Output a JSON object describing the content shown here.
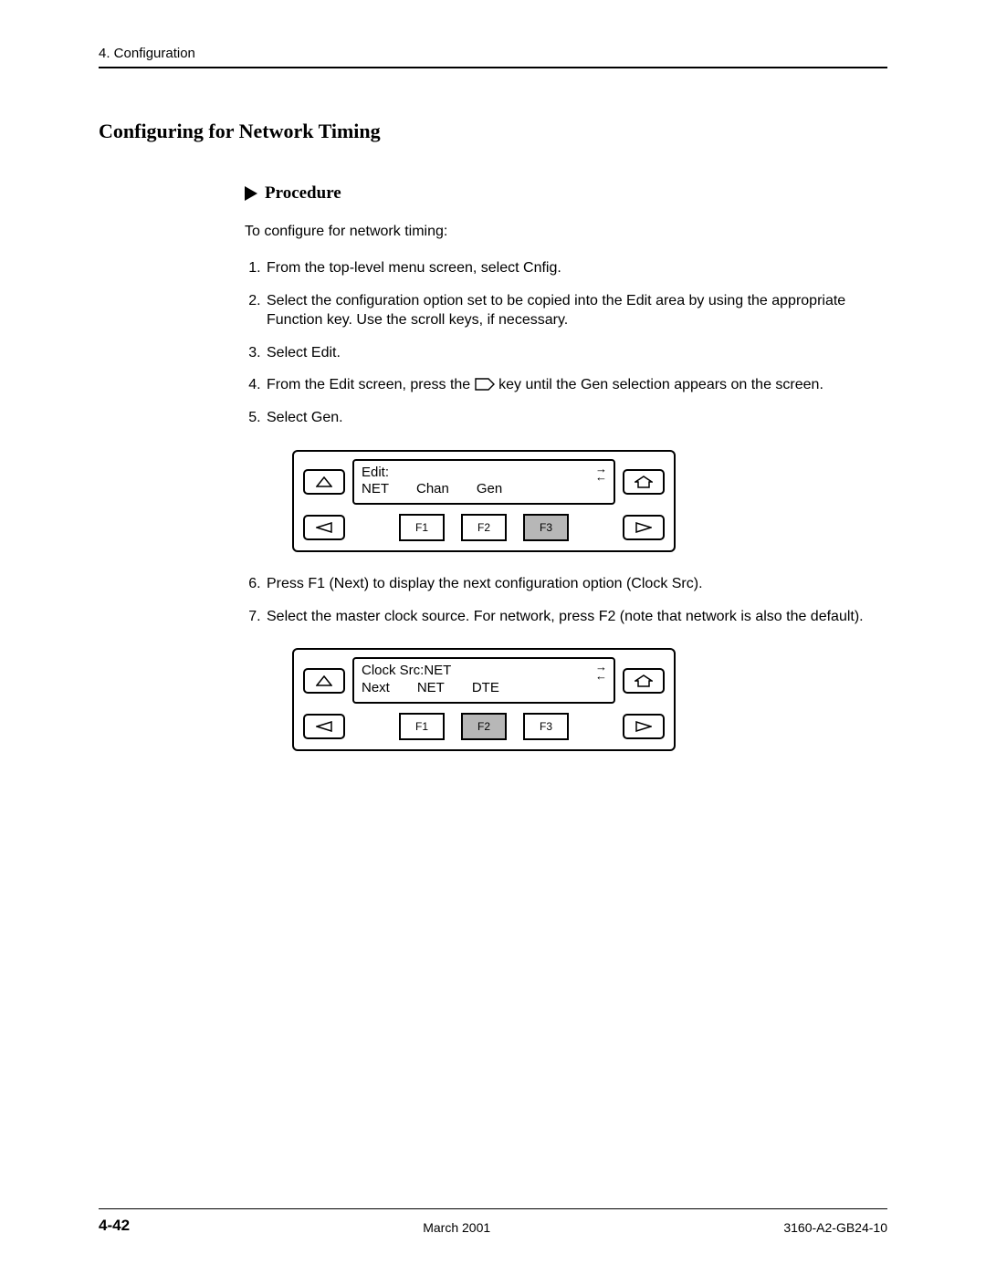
{
  "header": {
    "chapter": "4. Configuration"
  },
  "title": "Configuring for Network Timing",
  "procedure_label": "Procedure",
  "intro": "To configure for network timing:",
  "steps": {
    "s1": "From the top-level menu screen, select Cnfig.",
    "s2": "Select the configuration option set to be copied into the Edit area by using the appropriate Function key. Use the scroll keys, if necessary.",
    "s3": "Select Edit.",
    "s4a": "From the Edit screen, press the ",
    "s4b": " key until the Gen selection appears on the screen.",
    "s5": "Select Gen.",
    "s6": "Press F1 (Next) to display the next configuration option (Clock Src).",
    "s7": "Select the master clock source. For network, press F2 (note that network is also the default)."
  },
  "panel1": {
    "line1": "Edit:",
    "opt1": "NET",
    "opt2": "Chan",
    "opt3": "Gen",
    "f1": "F1",
    "f2": "F2",
    "f3": "F3"
  },
  "panel2": {
    "line1": "Clock Src:NET",
    "opt1": "Next",
    "opt2": "NET",
    "opt3": "DTE",
    "f1": "F1",
    "f2": "F2",
    "f3": "F3"
  },
  "footer": {
    "page": "4-42",
    "date": "March 2001",
    "docnum": "3160-A2-GB24-10"
  }
}
